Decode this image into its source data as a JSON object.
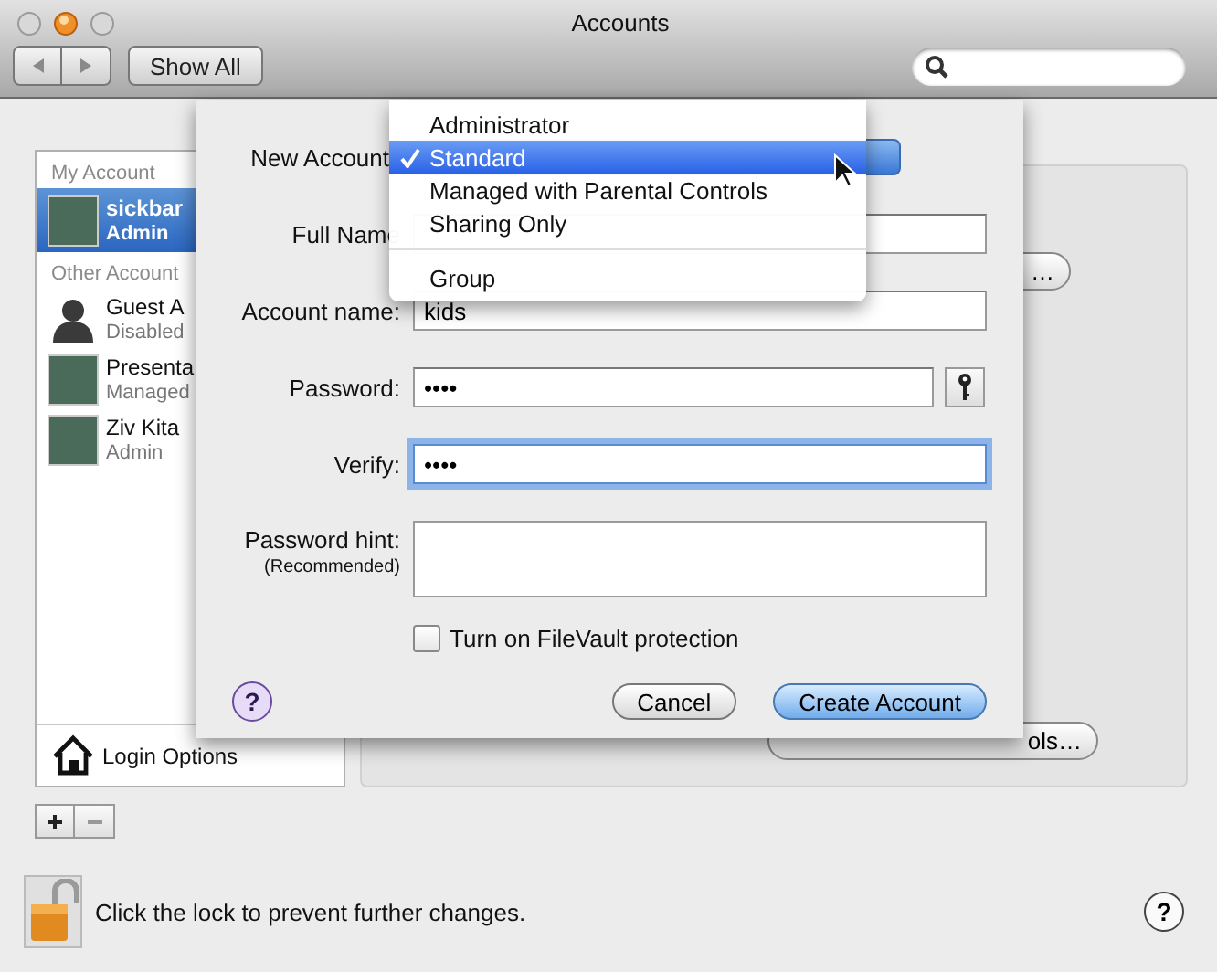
{
  "window": {
    "title": "Accounts",
    "show_all": "Show All"
  },
  "sidebar": {
    "sections": [
      {
        "heading": "My Account",
        "accounts": [
          {
            "name": "sickbar",
            "role": "Admin",
            "selected": true,
            "kind": "photo"
          }
        ]
      },
      {
        "heading": "Other Account",
        "accounts": [
          {
            "name": "Guest A",
            "role": "Disabled",
            "selected": false,
            "kind": "silhouette"
          },
          {
            "name": "Presenta",
            "role": "Managed",
            "selected": false,
            "kind": "photo"
          },
          {
            "name": "Ziv Kita",
            "role": "Admin",
            "selected": false,
            "kind": "photo"
          }
        ]
      }
    ],
    "login_options": "Login Options"
  },
  "panel": {
    "buttons": [
      "…",
      "ols…"
    ]
  },
  "sheet": {
    "new_account_label": "New Account",
    "fields": [
      {
        "label": "Full Name",
        "focused": false,
        "kind": "text"
      },
      {
        "label": "Account name:",
        "value": "kids",
        "focused": false,
        "kind": "text"
      },
      {
        "label": "Password:",
        "value": "••••",
        "focused": false,
        "kind": "password"
      },
      {
        "label": "Verify:",
        "value": "••••",
        "focused": true,
        "kind": "text"
      }
    ],
    "hint": {
      "label": "Password hint:",
      "note": "(Recommended)"
    },
    "filevault": {
      "label": "Turn on FileVault protection",
      "checked": false
    },
    "help": "?",
    "cancel": "Cancel",
    "create": "Create Account"
  },
  "menu": [
    {
      "kind": "item",
      "label": "Administrator",
      "selected": false
    },
    {
      "kind": "item",
      "label": "Standard",
      "selected": true
    },
    {
      "kind": "item",
      "label": "Managed with Parental Controls",
      "selected": false
    },
    {
      "kind": "item",
      "label": "Sharing Only",
      "selected": false
    },
    {
      "kind": "separator"
    },
    {
      "kind": "item",
      "label": "Group",
      "selected": false
    }
  ],
  "footer": {
    "lock_text": "Click the lock to prevent further changes.",
    "help": "?"
  }
}
